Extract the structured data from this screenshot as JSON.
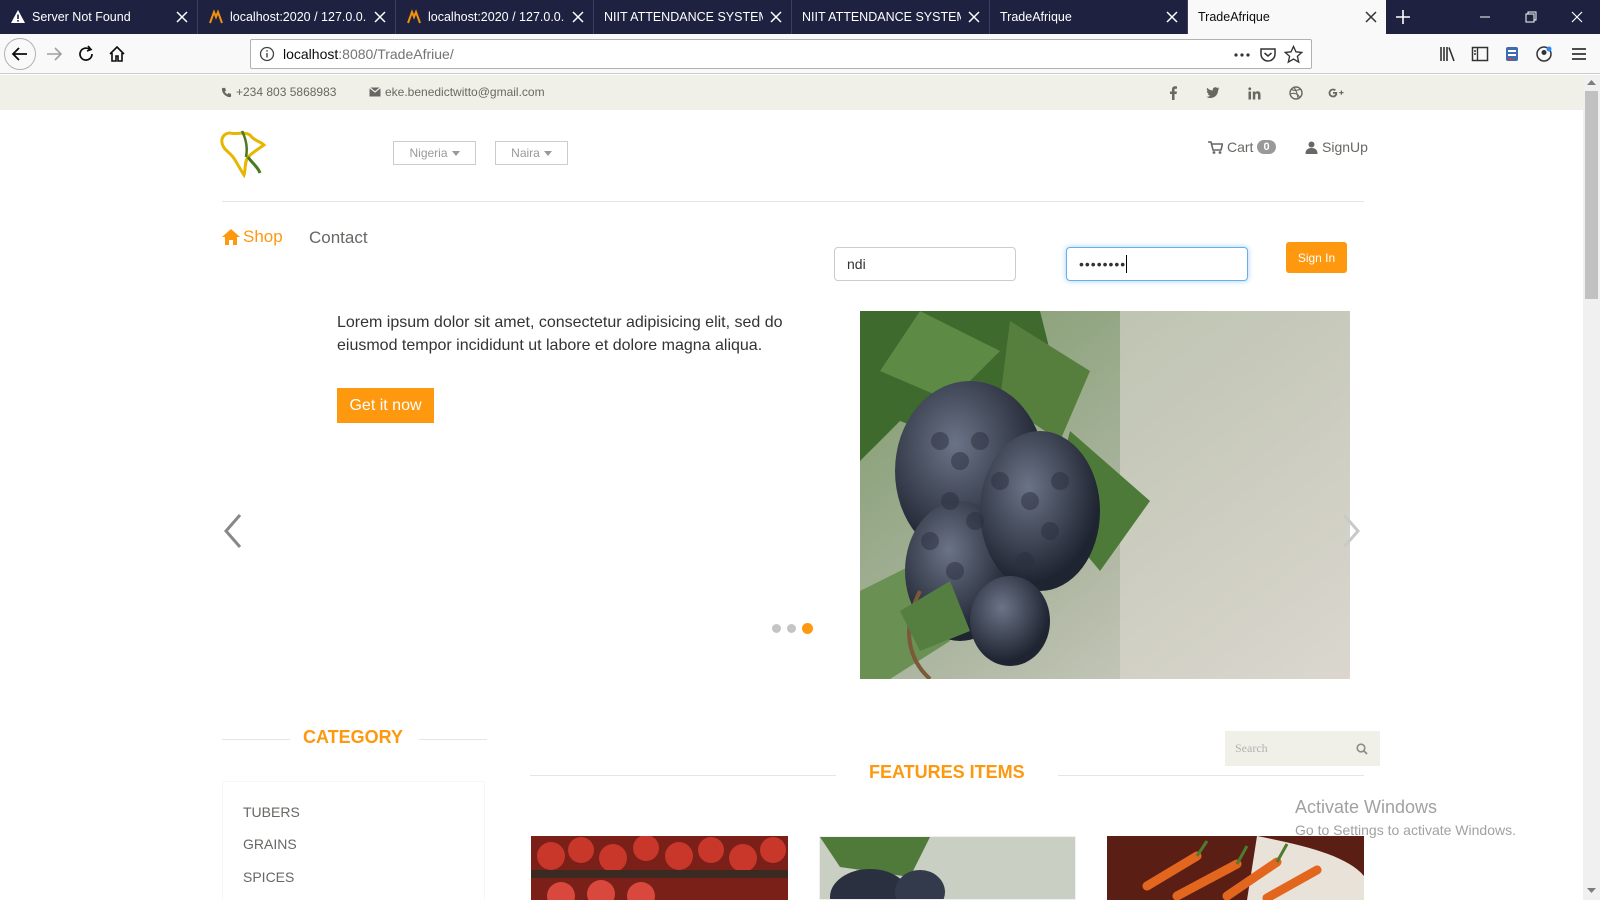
{
  "browser": {
    "tabs": [
      {
        "title": "Server Not Found",
        "icon": "warning-icon"
      },
      {
        "title": "localhost:2020 / 127.0.0.1 /",
        "icon": "phpmyadmin-icon"
      },
      {
        "title": "localhost:2020 / 127.0.0.1 /",
        "icon": "phpmyadmin-icon"
      },
      {
        "title": "NIIT ATTENDANCE SYSTEM",
        "icon": ""
      },
      {
        "title": "NIIT ATTENDANCE SYSTEM",
        "icon": ""
      },
      {
        "title": "TradeAfrique",
        "icon": ""
      },
      {
        "title": "TradeAfrique",
        "icon": "",
        "active": true
      }
    ],
    "url_host": "localhost",
    "url_rest": ":8080/TradeAfriue/"
  },
  "topstrip": {
    "phone": "+234 803 5868983",
    "email": "eke.benedictwitto@gmail.com",
    "social": [
      "f",
      "t",
      "in",
      "dribbble",
      "g+"
    ]
  },
  "header": {
    "country": "Nigeria",
    "currency": "Naira",
    "cart_label": "Cart",
    "cart_count": "0",
    "signup_label": "SignUp"
  },
  "nav": {
    "shop": "Shop",
    "contact": "Contact"
  },
  "login": {
    "username": "ndi",
    "password_mask": "••••••••",
    "signin_label": "Sign In"
  },
  "slider": {
    "text": "Lorem ipsum dolor sit amet, consectetur adipisicing elit, sed do eiusmod tempor incididunt ut labore et dolore magna aliqua.",
    "cta": "Get it now",
    "active_dot": 3,
    "dot_count": 3
  },
  "category": {
    "title": "CATEGORY",
    "items": [
      "TUBERS",
      "GRAINS",
      "SPICES"
    ]
  },
  "features": {
    "title": "FEATURES ITEMS",
    "search_placeholder": "Search"
  },
  "watermark": {
    "line1": "Activate Windows",
    "line2": "Go to Settings to activate Windows."
  },
  "colors": {
    "accent": "#fe980f",
    "tabbar": "#1e2140"
  }
}
